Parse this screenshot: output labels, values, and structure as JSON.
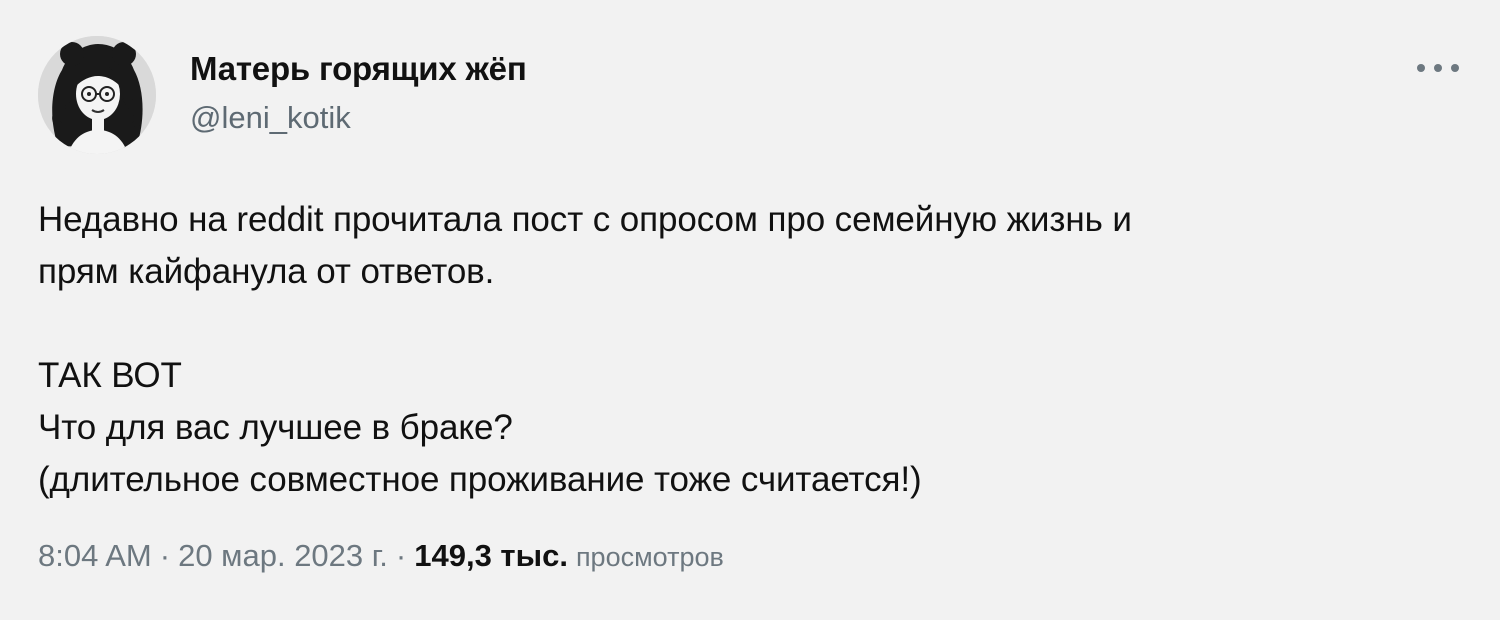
{
  "author": {
    "display_name": "Матерь горящих жёп",
    "handle": "@leni_kotik",
    "avatar_icon": "avatar-illustration"
  },
  "more_icon": "more-options-icon",
  "tweet": {
    "text": "Недавно на reddit прочитала пост с опросом про семейную жизнь и\nпрям кайфанула от ответов.\n\nТАК ВОТ\nЧто для вас лучшее в браке?\n(длительное совместное проживание тоже считается!)"
  },
  "meta": {
    "time": "8:04 AM",
    "separator_1": "·",
    "date": "20 мар. 2023 г.",
    "separator_2": "·",
    "views_count": "149,3 тыс.",
    "views_label": "просмотров"
  },
  "colors": {
    "background": "#f2f2f2",
    "text_primary": "#111111",
    "text_secondary": "#6d7880"
  }
}
